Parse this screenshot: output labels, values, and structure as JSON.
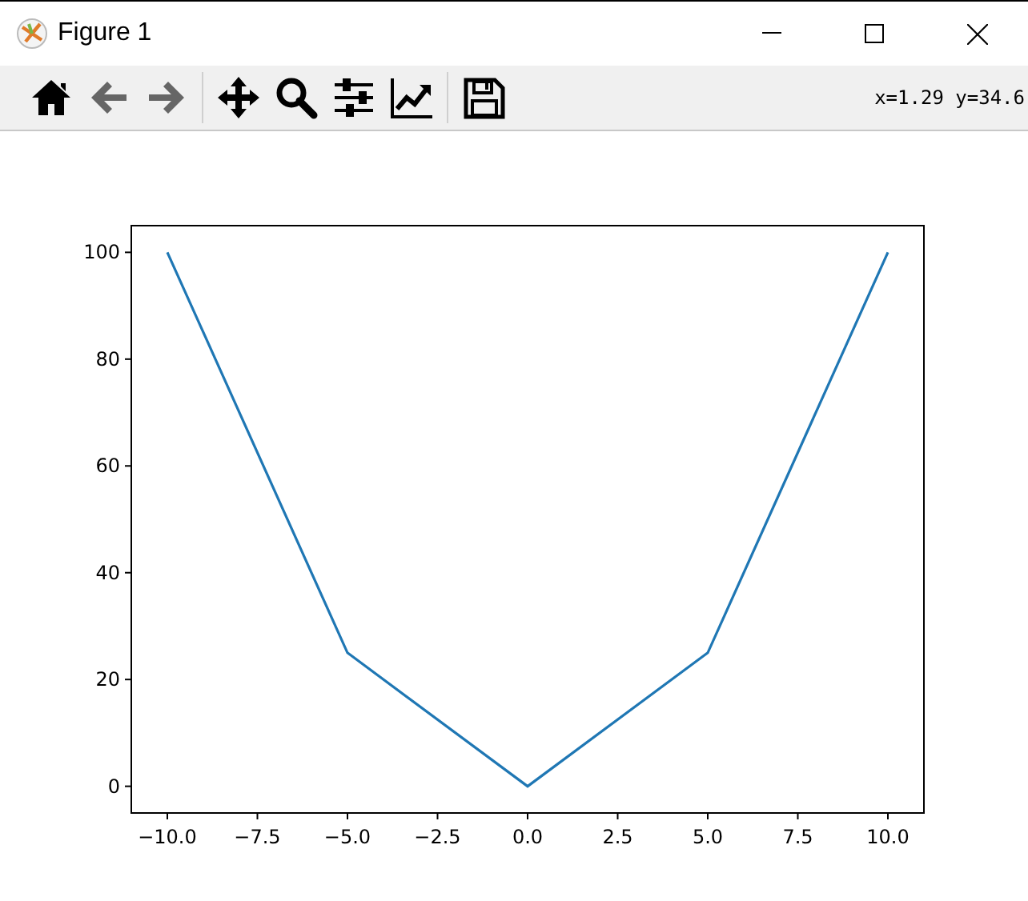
{
  "window": {
    "title": "Figure 1"
  },
  "toolbar": {
    "buttons": [
      {
        "kind": "home",
        "disabled": false
      },
      {
        "kind": "back",
        "disabled": true
      },
      {
        "kind": "forward",
        "disabled": true
      },
      {
        "kind": "separator"
      },
      {
        "kind": "pan",
        "disabled": false
      },
      {
        "kind": "zoom",
        "disabled": false
      },
      {
        "kind": "subplots",
        "disabled": false
      },
      {
        "kind": "customize",
        "disabled": false
      },
      {
        "kind": "separator"
      },
      {
        "kind": "save",
        "disabled": false
      }
    ],
    "coordinates": "x=1.29 y=34.6"
  },
  "figure": {
    "chart_data": {
      "type": "line",
      "x": [
        -10,
        -5,
        0,
        5,
        10
      ],
      "series": [
        {
          "color": "#1f77b4",
          "values": [
            100,
            25,
            0,
            25,
            100
          ]
        }
      ],
      "xlim": [
        -11,
        11
      ],
      "ylim": [
        -5,
        105
      ],
      "xticks": [
        {
          "value": -10,
          "label": "−10.0"
        },
        {
          "value": -7.5,
          "label": "−7.5"
        },
        {
          "value": -5,
          "label": "−5.0"
        },
        {
          "value": -2.5,
          "label": "−2.5"
        },
        {
          "value": 0,
          "label": "0.0"
        },
        {
          "value": 2.5,
          "label": "2.5"
        },
        {
          "value": 5,
          "label": "5.0"
        },
        {
          "value": 7.5,
          "label": "7.5"
        },
        {
          "value": 10,
          "label": "10.0"
        }
      ],
      "yticks": [
        {
          "value": 0,
          "label": "0"
        },
        {
          "value": 20,
          "label": "20"
        },
        {
          "value": 40,
          "label": "40"
        },
        {
          "value": 60,
          "label": "60"
        },
        {
          "value": 80,
          "label": "80"
        },
        {
          "value": 100,
          "label": "100"
        }
      ]
    }
  }
}
